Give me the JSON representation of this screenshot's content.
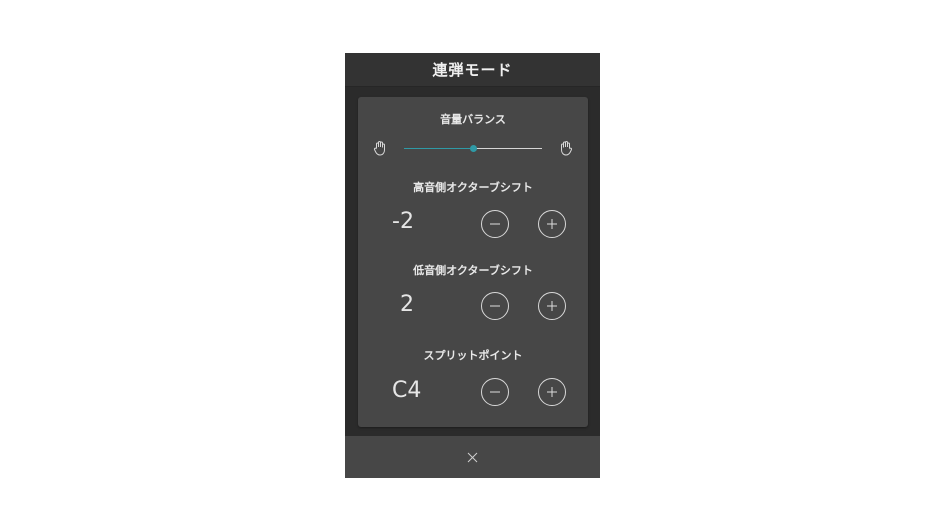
{
  "dialog": {
    "title": "連弾モード"
  },
  "balance": {
    "label": "音量バランス",
    "left_icon": "left-hand-icon",
    "right_icon": "right-hand-icon",
    "value_fraction": 0.5,
    "accent_color": "#2f9aa6"
  },
  "upper_octave": {
    "label": "高音側オクターブシフト",
    "value": "-2",
    "minus_icon": "minus-icon",
    "plus_icon": "plus-icon"
  },
  "lower_octave": {
    "label": "低音側オクターブシフト",
    "value": "2",
    "minus_icon": "minus-icon",
    "plus_icon": "plus-icon"
  },
  "split_point": {
    "label": "スプリットポイント",
    "value": "C4",
    "minus_icon": "minus-icon",
    "plus_icon": "plus-icon"
  },
  "footer": {
    "close_icon": "close-icon"
  }
}
